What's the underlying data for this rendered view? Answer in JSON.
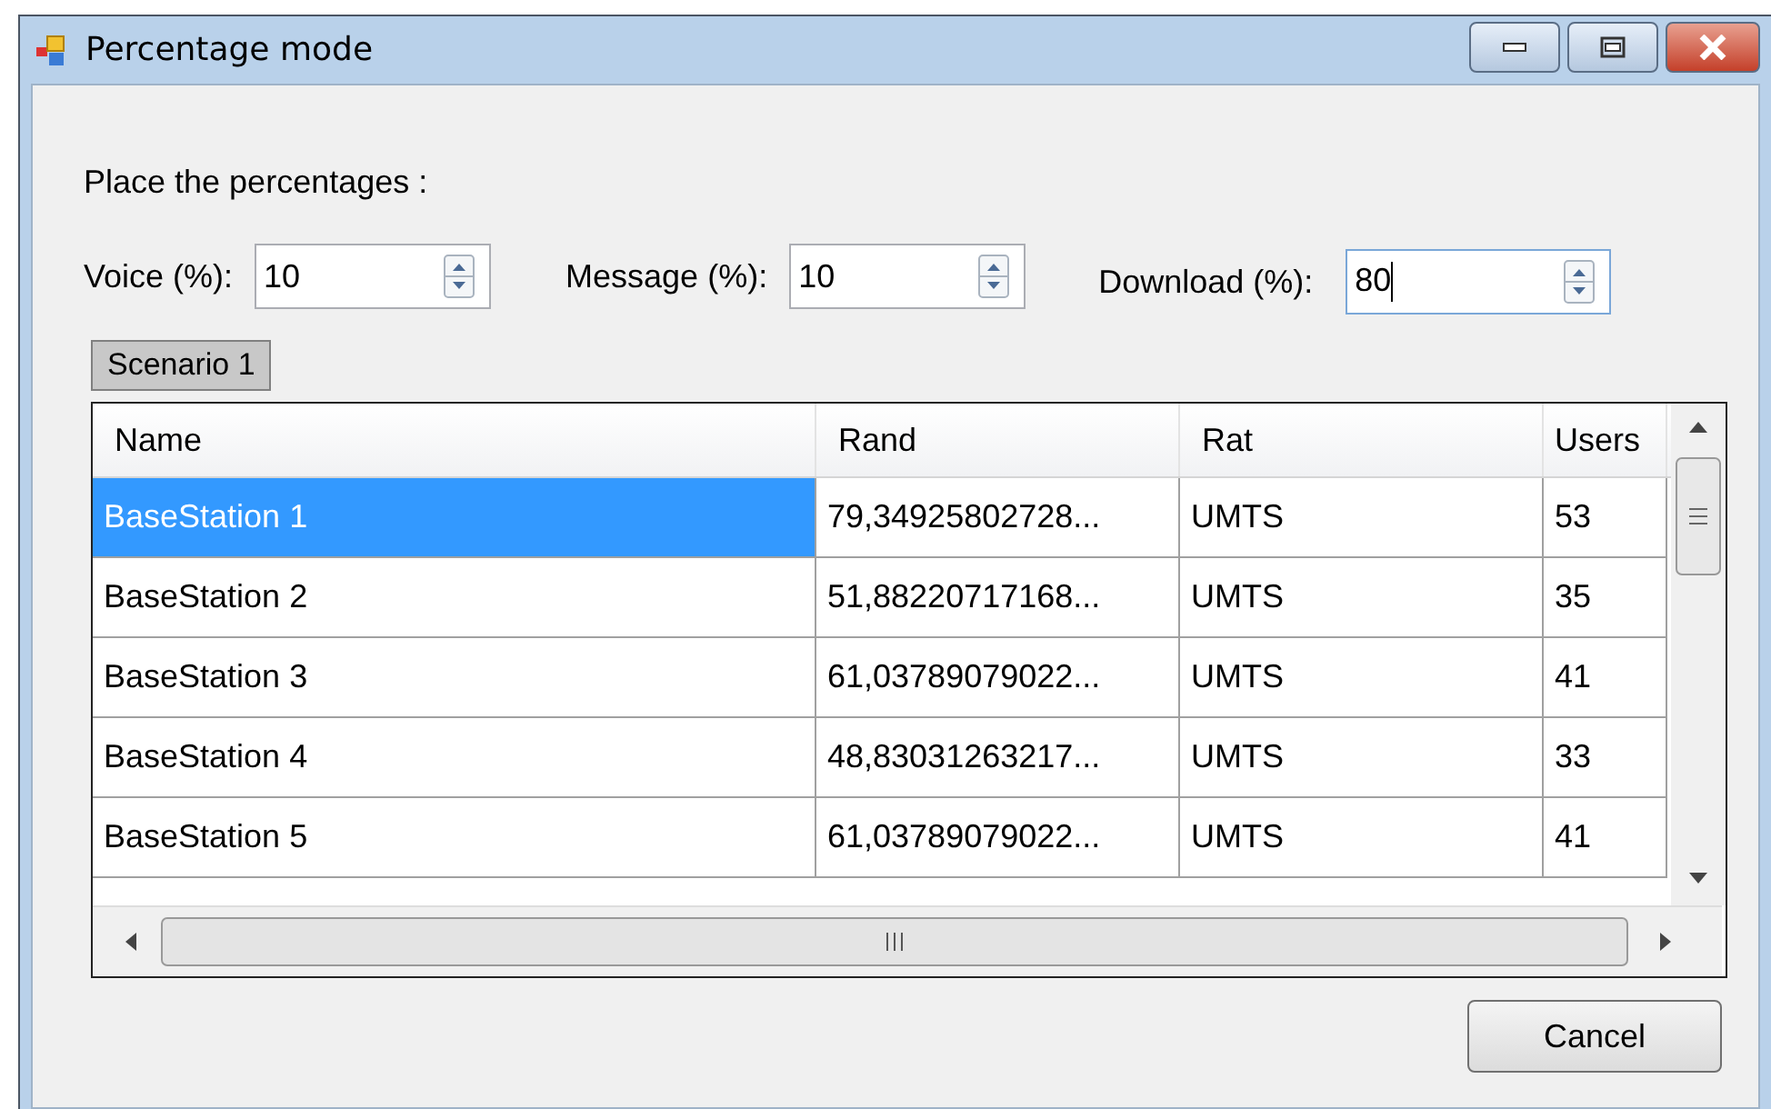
{
  "window": {
    "title": "Percentage mode"
  },
  "instruction": "Place the percentages :",
  "fields": [
    {
      "label": "Voice (%):",
      "value": "10",
      "focused": false
    },
    {
      "label": "Message (%):",
      "value": "10",
      "focused": false
    },
    {
      "label": "Download (%):",
      "value": "80",
      "focused": true
    }
  ],
  "scenario_label": "Scenario 1",
  "table": {
    "columns": [
      "Name",
      "Rand",
      "Rat",
      "Users"
    ],
    "rows": [
      {
        "cells": [
          "BaseStation 1",
          "79,34925802728...",
          "UMTS",
          "53"
        ],
        "selected": true
      },
      {
        "cells": [
          "BaseStation 2",
          "51,88220717168...",
          "UMTS",
          "35"
        ],
        "selected": false
      },
      {
        "cells": [
          "BaseStation 3",
          "61,03789079022...",
          "UMTS",
          "41"
        ],
        "selected": false
      },
      {
        "cells": [
          "BaseStation 4",
          "48,83031263217...",
          "UMTS",
          "33"
        ],
        "selected": false
      },
      {
        "cells": [
          "BaseStation 5",
          "61,03789079022...",
          "UMTS",
          "41"
        ],
        "selected": false
      }
    ]
  },
  "buttons": [
    "Cancel"
  ]
}
